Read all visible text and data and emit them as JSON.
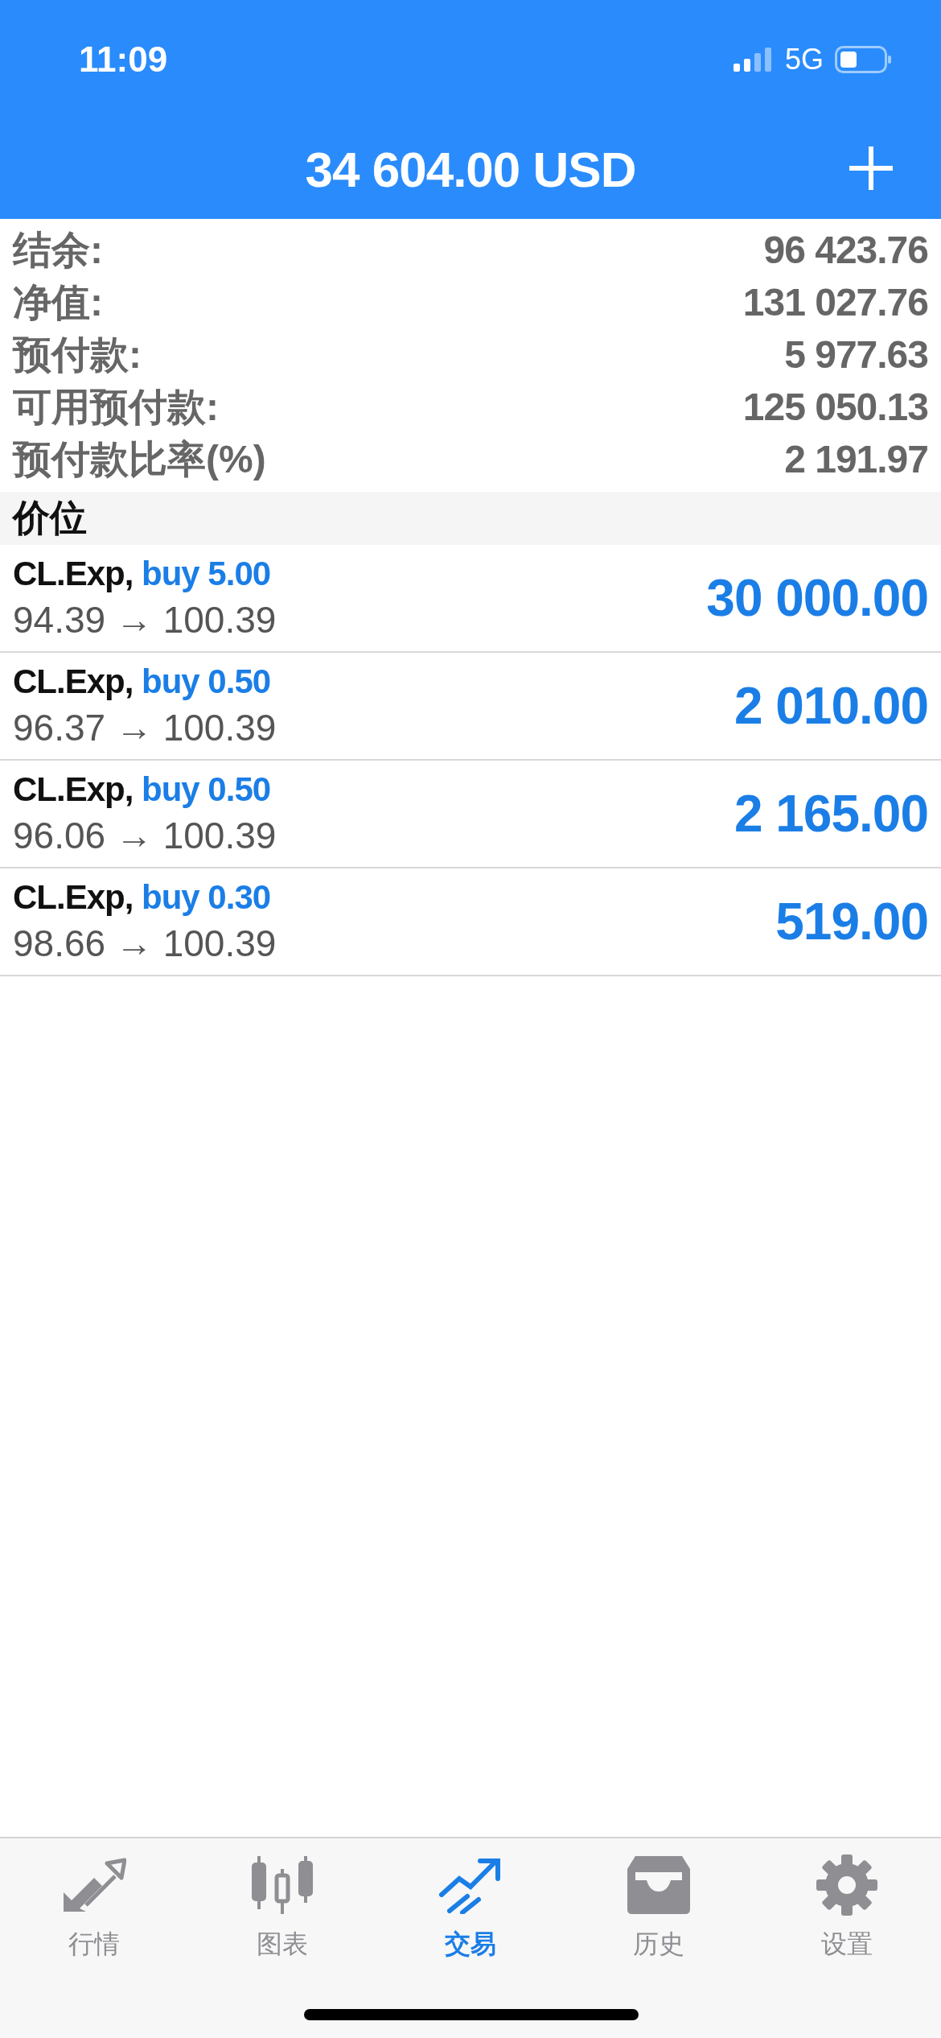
{
  "status_bar": {
    "time": "11:09",
    "network": "5G"
  },
  "header": {
    "title": "34 604.00 USD"
  },
  "summary": [
    {
      "label": "结余:",
      "value": "96 423.76"
    },
    {
      "label": "净值:",
      "value": "131 027.76"
    },
    {
      "label": "预付款:",
      "value": "5 977.63"
    },
    {
      "label": "可用预付款:",
      "value": "125 050.13"
    },
    {
      "label": "预付款比率(%)",
      "value": "2 191.97"
    }
  ],
  "section_title": "价位",
  "positions": [
    {
      "symbol": "CL.Exp,",
      "side": "buy 5.00",
      "prices": "94.39 → 100.39",
      "profit": "30 000.00"
    },
    {
      "symbol": "CL.Exp,",
      "side": "buy 0.50",
      "prices": "96.37 → 100.39",
      "profit": "2 010.00"
    },
    {
      "symbol": "CL.Exp,",
      "side": "buy 0.50",
      "prices": "96.06 → 100.39",
      "profit": "2 165.00"
    },
    {
      "symbol": "CL.Exp,",
      "side": "buy 0.30",
      "prices": "98.66 → 100.39",
      "profit": "519.00"
    }
  ],
  "tabs": [
    {
      "kind": "quotes",
      "label": "行情",
      "selected": false
    },
    {
      "kind": "chart",
      "label": "图表",
      "selected": false
    },
    {
      "kind": "trade",
      "label": "交易",
      "selected": true
    },
    {
      "kind": "history",
      "label": "历史",
      "selected": false
    },
    {
      "kind": "settings",
      "label": "设置",
      "selected": false
    }
  ]
}
